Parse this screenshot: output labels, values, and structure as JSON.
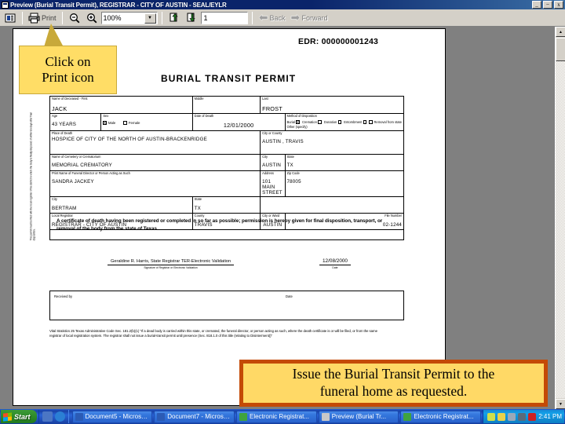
{
  "window": {
    "title": "Preview (Burial Transit Permit), REGISTRAR - CITY OF AUSTIN - SEAL/EYLR",
    "icon": "preview-window-icon",
    "minimize_label": "_",
    "maximize_label": "̶",
    "close_label": "x"
  },
  "toolbar": {
    "doc_icon": "document-properties-icon",
    "print_label": "Print",
    "print_icon": "printer-icon",
    "zoom_out_icon": "zoom-out-icon",
    "zoom_in_icon": "zoom-in-icon",
    "zoom_value": "100%",
    "zoom_dropdown_icon": "chevron-down-icon",
    "prev_page_icon": "previous-page-icon",
    "next_page_icon": "next-page-icon",
    "page_value": "1",
    "back_label": "Back",
    "back_icon": "arrow-left-icon",
    "forward_label": "Forward",
    "forward_icon": "arrow-right-icon"
  },
  "callouts": {
    "print_hint_line1": "Click on",
    "print_hint_line2": "Print icon",
    "instruction_line1": "Issue the Burial Transit Permit to the",
    "instruction_line2": "funeral home as requested.",
    "yellow_bg": "#ffdd66",
    "red_border": "#c44a06"
  },
  "document": {
    "edr": "EDR: 000000001243",
    "title": "BURIAL TRANSIT PERMIT",
    "side_note": "This permit must be filed with the local registrar of the district in which the body is finally disposed of within ten days after final disposition.",
    "side_note2": "State File Number",
    "fields": {
      "name_label": "Name of Deceased - First",
      "name_value": "JACK",
      "middle_label": "Middle",
      "middle_value": "",
      "last_label": "Last",
      "last_value": "FROST",
      "age_label": "Age",
      "age_value": "43  YEARS",
      "sex_label": "Sex",
      "sex_male": "Male",
      "sex_female": "Female",
      "sex_selected": "Male",
      "dod_label": "Date of Death",
      "dod_value": "12/01/2000",
      "disposition_label": "Method of Disposition",
      "disposition_options": [
        "Burial",
        "Cremation",
        "Donation",
        "Entombment",
        "Removal from state"
      ],
      "disposition_selected": "Burial",
      "disposition_other_label": "Other (specify)",
      "place_label": "Place of Death",
      "place_value": "HOSPICE OF CITY OF THE NORTH OF AUSTIN-BRACKENRIDGE",
      "place_city_label": "City or County",
      "place_city_value": "AUSTIN , TRAVIS",
      "cemetery_label": "Name of Cemetery or Crematorium",
      "cemetery_value": "MEMORIAL CREMATORY",
      "cemetery_city_label": "City",
      "cemetery_city_value": "AUSTIN",
      "cemetery_state_label": "State",
      "cemetery_state_value": "TX",
      "fd_label": "Print Name of Funeral Director or Person Acting as Such",
      "fd_value": "SANDRA JACKEY",
      "fd_addr_label": "Address",
      "fd_addr_value": "101 MAIN STREET",
      "fd_city_label": "City",
      "fd_city_value": "BERTRAM",
      "fd_state_label": "State",
      "fd_state_value": "TX",
      "fd_zip_label": "Zip Code",
      "fd_zip_value": "78005",
      "reg_label": "Local Registrar",
      "reg_value": "REGISTRAR - CITY OF AUSTIN",
      "reg_county_label": "County",
      "reg_county_value": "TRAVIS",
      "reg_city_label": "City or Ward",
      "reg_city_value": "AUSTIN",
      "reg_file_label": "File Number",
      "reg_file_value": "02-1244"
    },
    "certificate_text": "A certificate of death having been registered or completed in so far as possible; permission is hereby given for final disposition, transport, or removal of the body from the state of Texas.",
    "signature_name": "Geraldine R. Harris, State Registrar  TER-Electronic Validation",
    "signature_caption": "Signature of Registrar or Electronic Validation",
    "signature_date": "12/08/2000",
    "signature_date_caption": "Date",
    "received_label": "Received by",
    "received_date_label": "Date",
    "fine_print": "Vital Statistics 25 Texas Administrative Code Sec. 181.2(b)(1) \"If a dead body is carried within this state, or cremated, the funeral director, or person acting as such, where the death certificate is or will be filed, or from the same registrar of local registration system. The registrar shall not issue a burial-transit permit until presence (Sec. 818.1.0 of this title (relating to Disinterment))\""
  },
  "taskbar": {
    "start_label": "Start",
    "quick_launch": [
      "show-desktop-icon",
      "internet-explorer-icon"
    ],
    "tasks": [
      {
        "icon": "word-icon",
        "label": "Document5 - Microsof..."
      },
      {
        "icon": "word-icon",
        "label": "Document7 - Microso..."
      },
      {
        "icon": "app-icon",
        "label": "Electronic Registrat..."
      },
      {
        "icon": "preview-icon",
        "label": "Preview (Burial Tr..."
      },
      {
        "icon": "app-icon",
        "label": "Electronic Registrat..."
      }
    ],
    "tray_icons": [
      "network-icon",
      "edit-icon",
      "shield-icon",
      "speaker-icon",
      "norton-icon"
    ],
    "clock": "2:41 PM"
  }
}
